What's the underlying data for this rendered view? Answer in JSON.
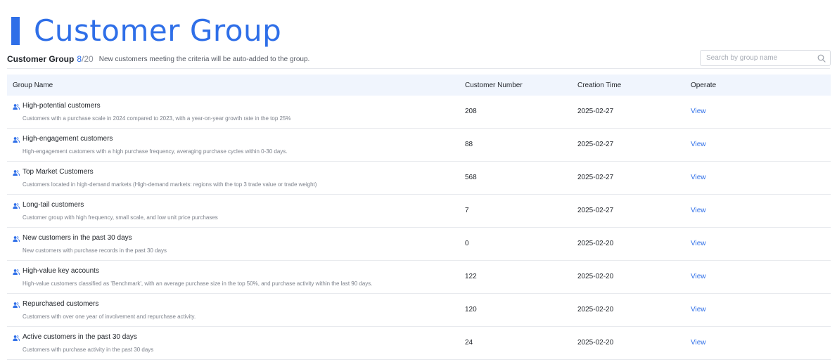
{
  "header": {
    "title": "Customer Group"
  },
  "subheader": {
    "label": "Customer Group",
    "count": "8",
    "separator": "/",
    "total": "20",
    "note": "New customers meeting the criteria will be auto-added to the group."
  },
  "search": {
    "placeholder": "Search by group name",
    "value": ""
  },
  "table": {
    "columns": {
      "name": "Group Name",
      "number": "Customer Number",
      "time": "Creation Time",
      "operate": "Operate"
    },
    "rows": [
      {
        "title": "High-potential customers",
        "desc": "Customers with a purchase scale in 2024 compared to 2023, with a year-on-year growth rate in the top 25%",
        "number": "208",
        "time": "2025-02-27",
        "action": "View"
      },
      {
        "title": "High-engagement customers",
        "desc": "High-engagement customers with a high purchase frequency, averaging purchase cycles within 0-30 days.",
        "number": "88",
        "time": "2025-02-27",
        "action": "View"
      },
      {
        "title": "Top Market Customers",
        "desc": "Customers located in high-demand markets (High-demand markets: regions with the top 3 trade value or trade weight)",
        "number": "568",
        "time": "2025-02-27",
        "action": "View"
      },
      {
        "title": "Long-tail customers",
        "desc": "Customer group with high frequency, small scale, and low unit price purchases",
        "number": "7",
        "time": "2025-02-27",
        "action": "View"
      },
      {
        "title": "New customers in the past 30 days",
        "desc": "New customers with purchase records in the past 30 days",
        "number": "0",
        "time": "2025-02-20",
        "action": "View"
      },
      {
        "title": "High-value key accounts",
        "desc": "High-value customers classified as 'Benchmark', with an average purchase size in the top 50%, and purchase activity within the last 90 days.",
        "number": "122",
        "time": "2025-02-20",
        "action": "View"
      },
      {
        "title": "Repurchased customers",
        "desc": "Customers with over one year of involvement and repurchase activity.",
        "number": "120",
        "time": "2025-02-20",
        "action": "View"
      },
      {
        "title": "Active customers in the past 30 days",
        "desc": "Customers with purchase activity in the past 30 days",
        "number": "24",
        "time": "2025-02-20",
        "action": "View"
      }
    ]
  },
  "icons": {
    "row": "user-group-icon",
    "search": "search-icon"
  },
  "colors": {
    "accent": "#2f6fe8",
    "header_bg": "#f0f5fd"
  }
}
